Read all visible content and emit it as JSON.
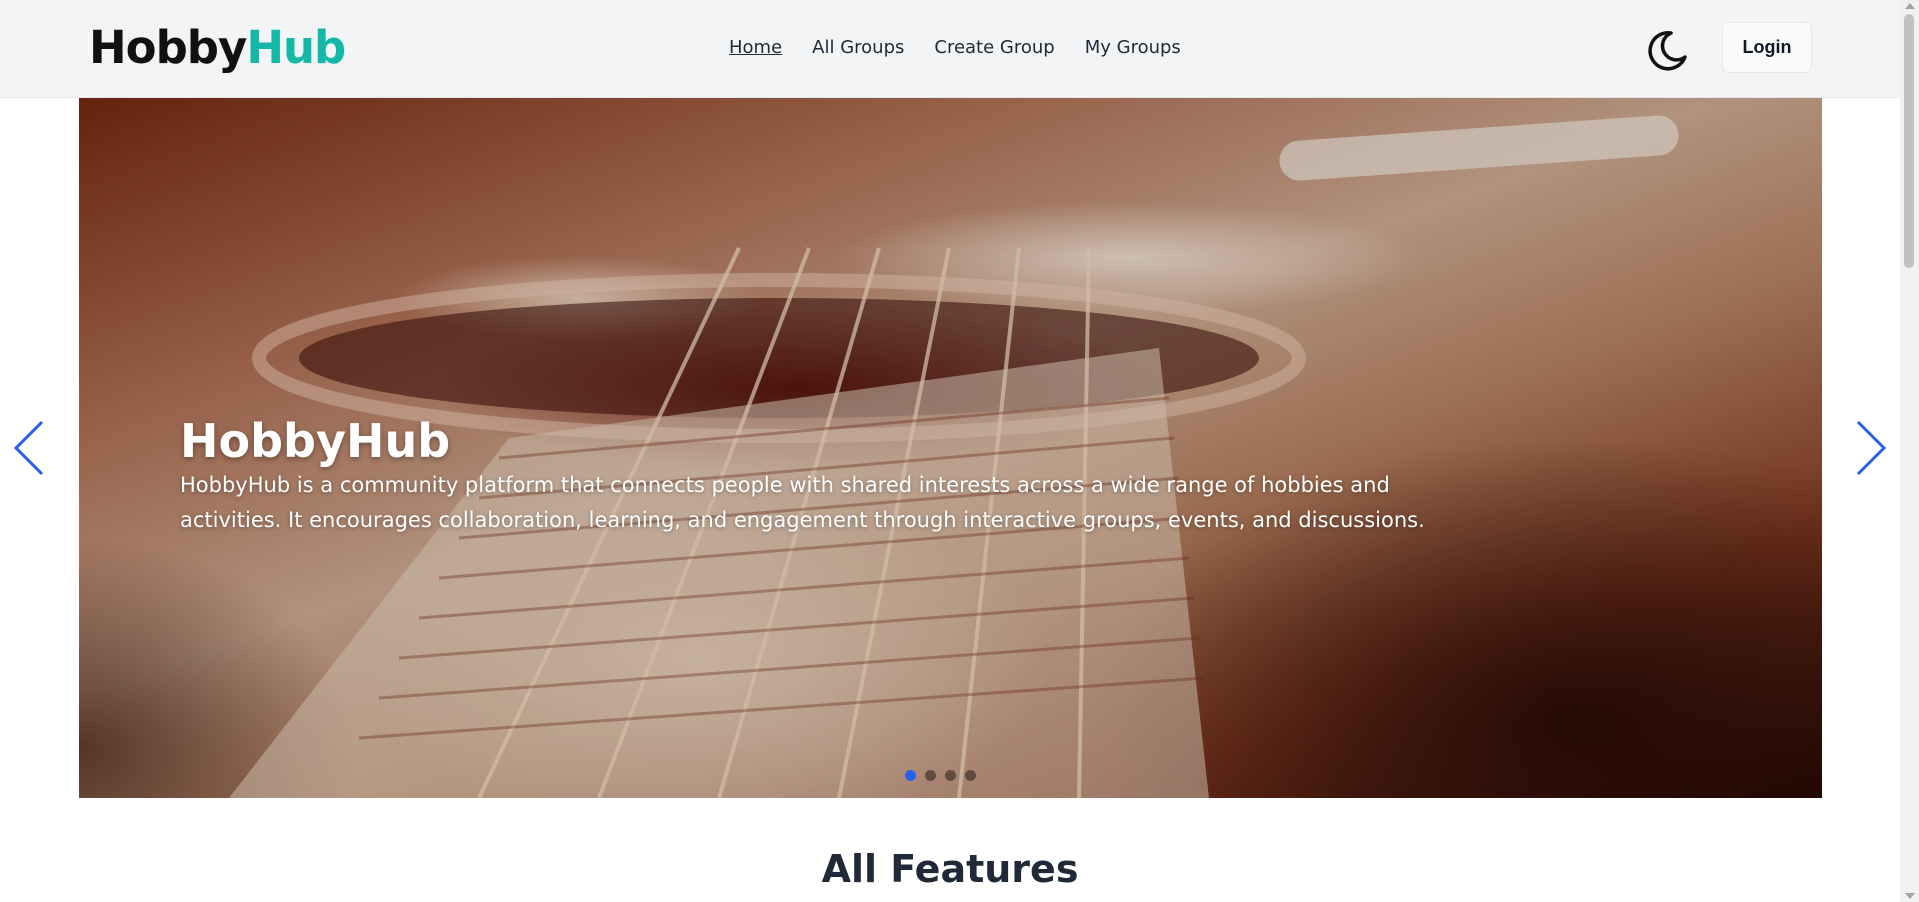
{
  "brand": {
    "name_main": "Hobby",
    "name_accent": "Hub",
    "accent_color": "#14b8a6"
  },
  "nav": {
    "links": [
      {
        "label": "Home",
        "active": true
      },
      {
        "label": "All Groups",
        "active": false
      },
      {
        "label": "Create Group",
        "active": false
      },
      {
        "label": "My Groups",
        "active": false
      }
    ],
    "theme_icon": "moon-icon",
    "login_label": "Login"
  },
  "hero": {
    "title": "HobbyHub",
    "description": "HobbyHub is a community platform that connects people with shared interests across a wide range of hobbies and activities. It encourages collaboration, learning, and engagement through interactive groups, events, and discussions.",
    "slide_count": 4,
    "active_slide": 1,
    "arrow_color": "#2563eb",
    "prev_icon": "chevron-left-icon",
    "next_icon": "chevron-right-icon"
  },
  "features": {
    "title": "All Features"
  }
}
